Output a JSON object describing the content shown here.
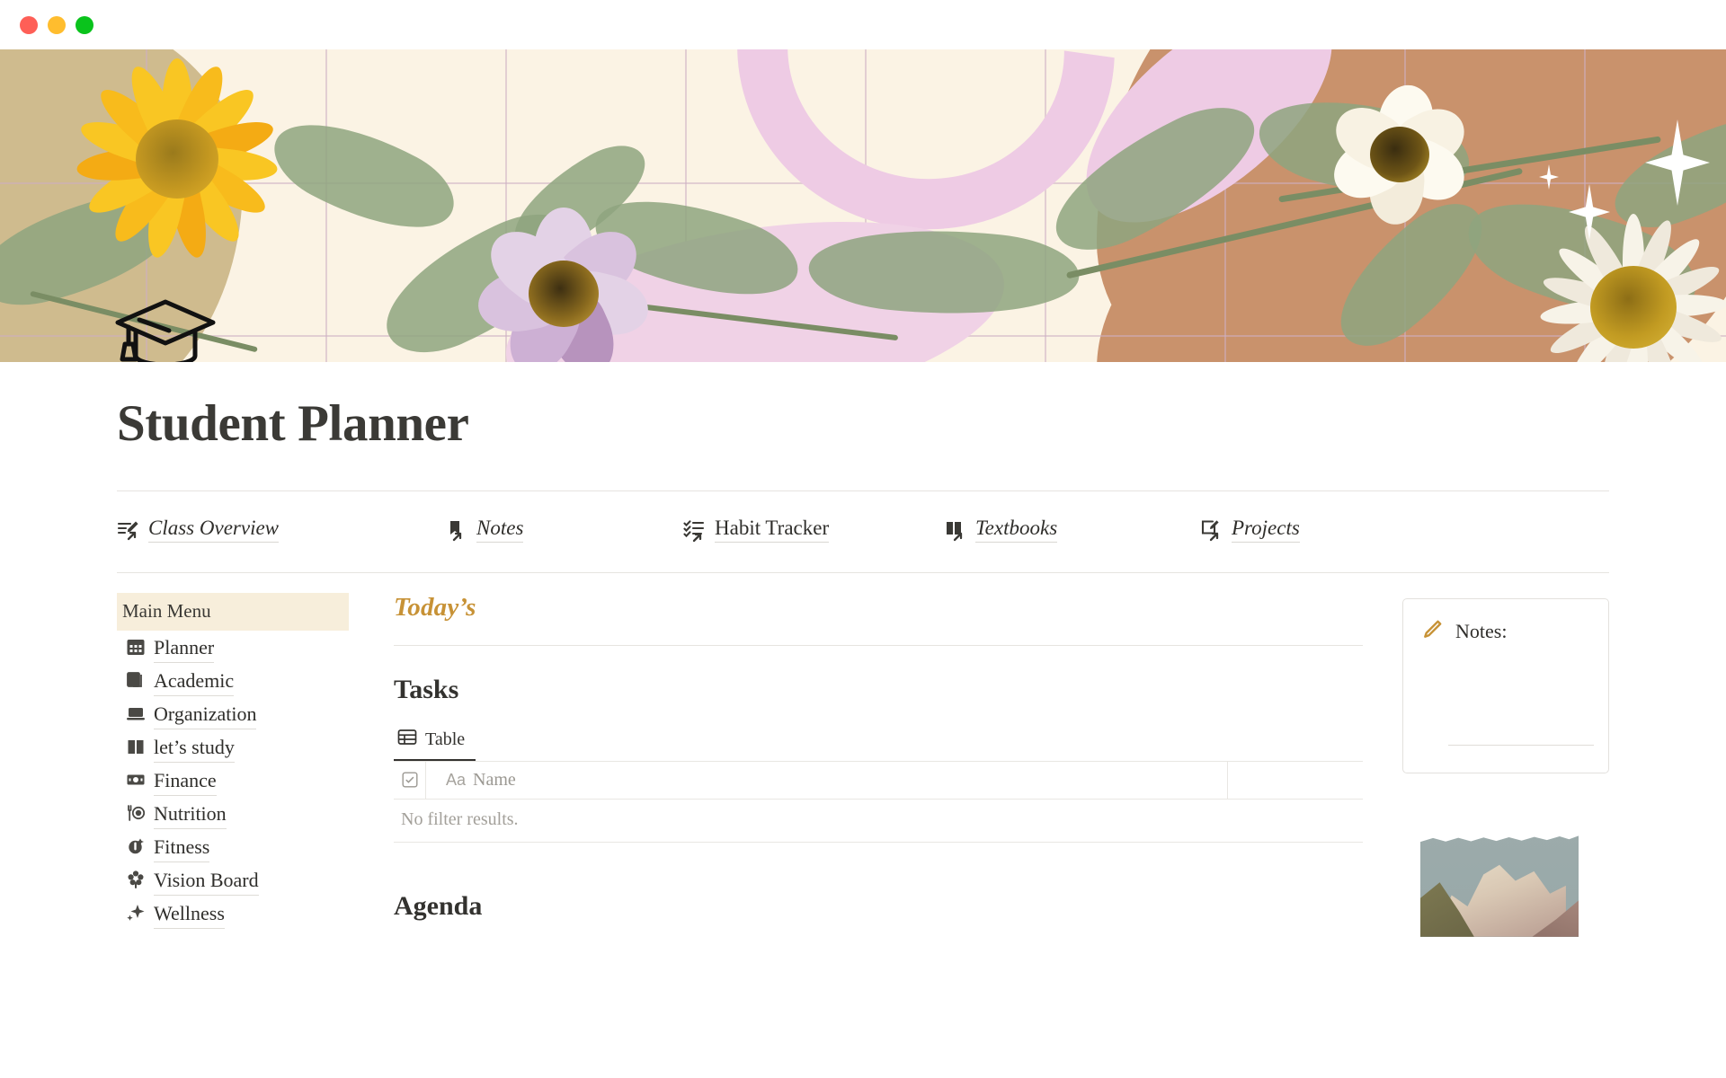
{
  "window": {
    "traffic_lights": [
      "close",
      "minimize",
      "maximize"
    ],
    "colors": {
      "close": "#fe5f57",
      "minimize": "#ffbd2e",
      "maximize": "#0ac31c"
    }
  },
  "banner": {
    "icon": "graduation-cap-icon",
    "background_color": "#fbf3e4",
    "accent_colors": {
      "tan": "#cfbb8e",
      "terracotta": "#c9926c",
      "pink": "#eecbe4",
      "sage": "#8ea47f",
      "grid_line": "#cdafc3"
    }
  },
  "header": {
    "title": "Student Planner"
  },
  "nav": {
    "items": [
      {
        "label": "Class Overview",
        "icon": "list-edit-icon",
        "italic": true
      },
      {
        "label": "Notes",
        "icon": "bookmark-icon",
        "italic": true
      },
      {
        "label": "Habit Tracker",
        "icon": "checklist-icon",
        "italic": false
      },
      {
        "label": "Textbooks",
        "icon": "open-book-icon",
        "italic": true
      },
      {
        "label": "Projects",
        "icon": "edit-square-icon",
        "italic": true
      }
    ]
  },
  "sidebar": {
    "heading": "Main Menu",
    "heading_bg": "#f7eedb",
    "items": [
      {
        "label": "Planner",
        "icon": "calendar-icon"
      },
      {
        "label": "Academic",
        "icon": "books-stack-icon"
      },
      {
        "label": "Organization",
        "icon": "laptop-icon"
      },
      {
        "label": "let’s study",
        "icon": "open-book-icon"
      },
      {
        "label": "Finance",
        "icon": "banknote-icon"
      },
      {
        "label": "Nutrition",
        "icon": "fork-plate-icon"
      },
      {
        "label": "Fitness",
        "icon": "dumbbell-icon"
      },
      {
        "label": "Vision Board",
        "icon": "flower-icon"
      },
      {
        "label": "Wellness",
        "icon": "sparkles-icon"
      }
    ]
  },
  "main": {
    "today_label": "Today’s",
    "today_color": "#c79236",
    "tasks": {
      "title": "Tasks",
      "tabs": [
        {
          "label": "Table",
          "icon": "table-icon",
          "active": true
        }
      ],
      "table": {
        "checkbox_header_icon": "checkbox-icon",
        "columns": [
          {
            "label": "Name",
            "type_icon": "Aa"
          }
        ],
        "rows": [],
        "empty_message": "No filter results."
      }
    },
    "agenda": {
      "title": "Agenda"
    }
  },
  "rail": {
    "notes": {
      "title": "Notes:",
      "icon": "pencil-icon",
      "icon_color": "#c79236",
      "body": ""
    },
    "photo": {
      "alt": "mountain-photo"
    }
  }
}
